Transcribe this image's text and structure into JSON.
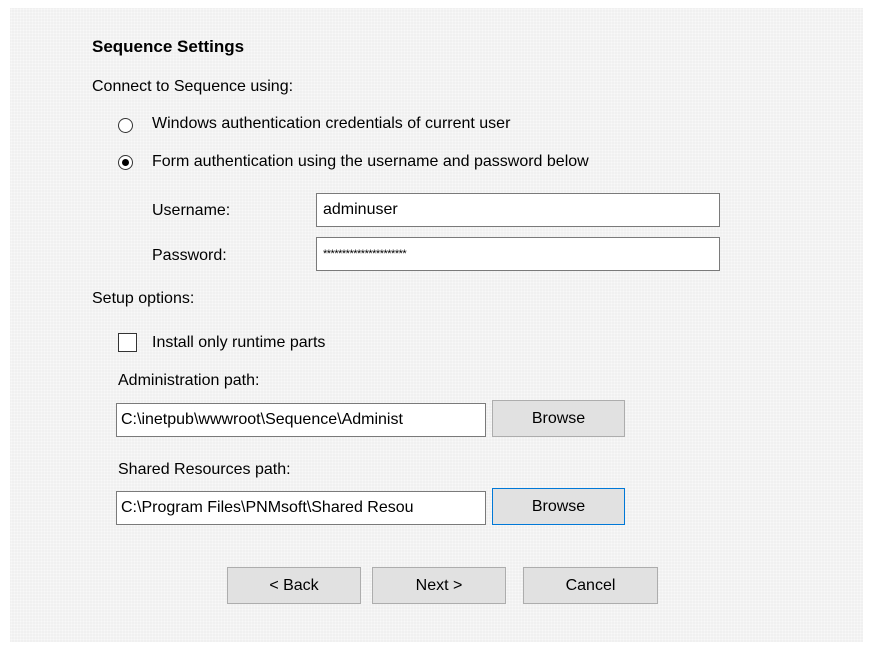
{
  "dialog": {
    "title": "Sequence Settings",
    "connect_label": "Connect to Sequence using:",
    "auth_options": [
      {
        "label": "Windows authentication credentials of current user",
        "selected": false
      },
      {
        "label": "Form authentication using the username and password below",
        "selected": true
      }
    ],
    "username": {
      "label": "Username:",
      "value": "adminuser"
    },
    "password": {
      "label": "Password:",
      "value": "**********************"
    },
    "setup_label": "Setup options:",
    "runtime_checkbox": {
      "label": "Install only runtime parts",
      "checked": false
    },
    "admin_path": {
      "label": "Administration path:",
      "value": "C:\\inetpub\\wwwroot\\Sequence\\Administ",
      "browse_label": "Browse"
    },
    "shared_path": {
      "label": "Shared Resources path:",
      "value": "C:\\Program Files\\PNMsoft\\Shared Resou",
      "browse_label": "Browse"
    },
    "buttons": {
      "back": "< Back",
      "next": "Next >",
      "cancel": "Cancel"
    }
  }
}
